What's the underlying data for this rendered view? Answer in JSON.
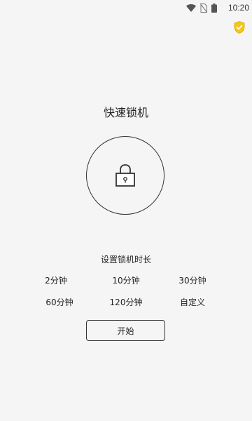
{
  "status_bar": {
    "time": "10:20",
    "icons": [
      "wifi-icon",
      "no-sim-icon",
      "battery-icon"
    ]
  },
  "header": {
    "shield_icon": "shield-check-icon",
    "shield_color": "#f5c518"
  },
  "main": {
    "title": "快速锁机",
    "lock_icon": "lock-icon",
    "duration_label": "设置锁机时长",
    "options": [
      "2分钟",
      "10分钟",
      "30分钟",
      "60分钟",
      "120分钟",
      "自定义"
    ],
    "start_label": "开始"
  }
}
